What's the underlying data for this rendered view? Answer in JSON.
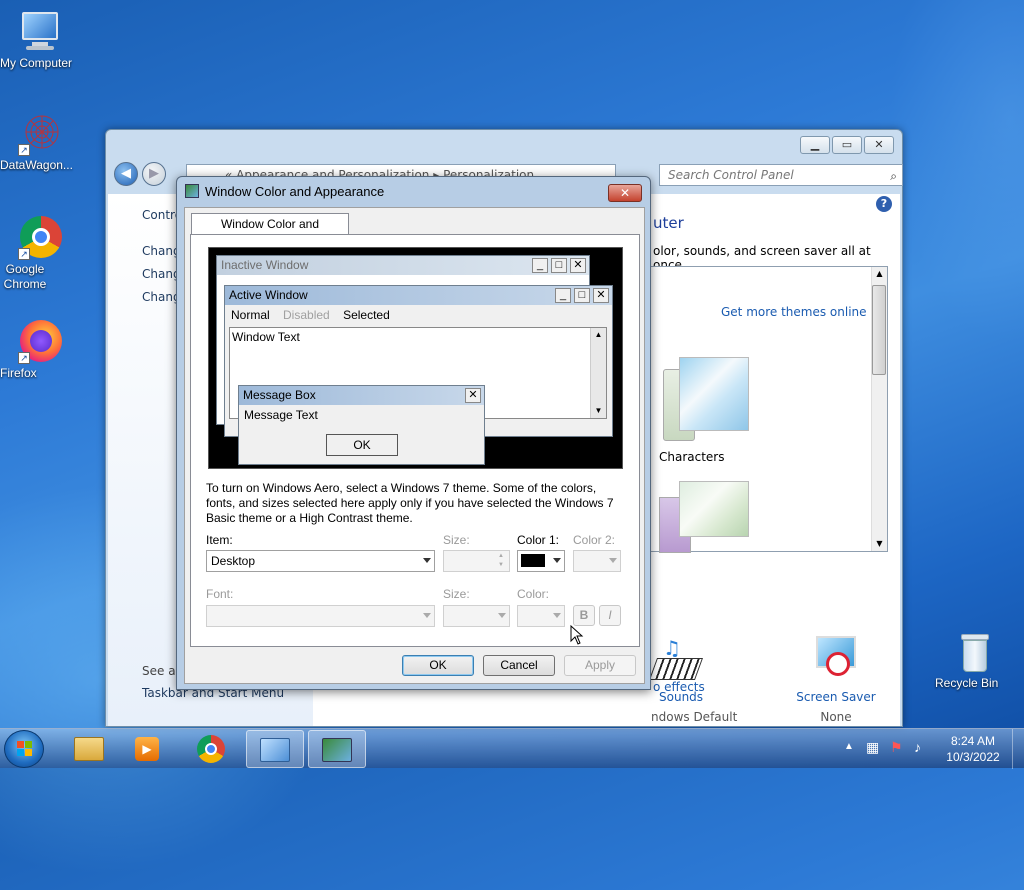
{
  "desktop": {
    "icons": [
      {
        "label": "My Computer"
      },
      {
        "label": "DataWagon..."
      },
      {
        "label": "Google Chrome"
      },
      {
        "label": "Firefox"
      },
      {
        "label": "Recycle Bin"
      }
    ]
  },
  "control_panel": {
    "address": [
      "«",
      "Appearance and Personalization",
      "▸",
      "Personalization"
    ],
    "search_placeholder": "Search Control Panel",
    "left_pane": {
      "heading": "Contro",
      "links": [
        "Chang",
        "Chang",
        "Chang"
      ],
      "see_also": "See als",
      "taskbar_link": "Taskbar and Start Menu"
    },
    "title_partial": "uter",
    "description": "olor, sounds, and screen saver all at once.",
    "get_more_themes": "Get more themes online",
    "theme_label": "Characters",
    "sounds": {
      "label": "Sounds",
      "value": "ndows Default"
    },
    "screen_saver": {
      "label": "Screen Saver",
      "value": "None"
    },
    "effects_link": "o effects"
  },
  "dialog": {
    "title": "Window Color and Appearance",
    "tab": "Window Color and Appearance",
    "preview": {
      "inactive_title": "Inactive Window",
      "active_title": "Active Window",
      "menu_normal": "Normal",
      "menu_disabled": "Disabled",
      "menu_selected": "Selected",
      "window_text": "Window Text",
      "msgbox_title": "Message Box",
      "msgbox_text": "Message Text",
      "msgbox_ok": "OK"
    },
    "info": "To turn on Windows Aero, select a Windows 7 theme.  Some of the colors, fonts, and sizes selected here apply only if you have selected the Windows 7 Basic theme or a High Contrast theme.",
    "item_label": "Item:",
    "item_value": "Desktop",
    "size_label": "Size:",
    "color1_label": "Color 1:",
    "color1_value": "#000000",
    "color2_label": "Color 2:",
    "font_label": "Font:",
    "font_size_label": "Size:",
    "font_color_label": "Color:",
    "bold": "B",
    "italic": "I",
    "ok": "OK",
    "cancel": "Cancel",
    "apply": "Apply"
  },
  "taskbar": {
    "time": "8:24 AM",
    "date": "10/3/2022"
  }
}
